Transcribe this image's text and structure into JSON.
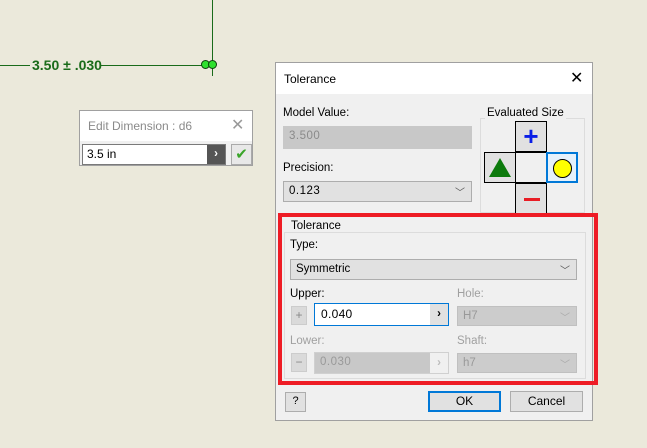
{
  "canvas": {
    "dimension_text": "3.50 ± .030"
  },
  "edit_dimension": {
    "title": "Edit Dimension : d6",
    "value": "3.5 in"
  },
  "dialog": {
    "title": "Tolerance",
    "model_value_label": "Model Value:",
    "model_value": "3.500",
    "precision_label": "Precision:",
    "precision": "0.123",
    "evaluated_size_label": "Evaluated Size",
    "tolerance_group_label": "Tolerance",
    "type_label": "Type:",
    "type": "Symmetric",
    "upper_label": "Upper:",
    "upper": "0.040",
    "lower_label": "Lower:",
    "lower": "0.030",
    "hole_label": "Hole:",
    "hole": "H7",
    "shaft_label": "Shaft:",
    "shaft": "h7",
    "ok": "OK",
    "cancel": "Cancel"
  },
  "colors": {
    "highlight": "#ee1c25",
    "accent": "#0078d7",
    "dim_green": "#1a6b1a"
  }
}
